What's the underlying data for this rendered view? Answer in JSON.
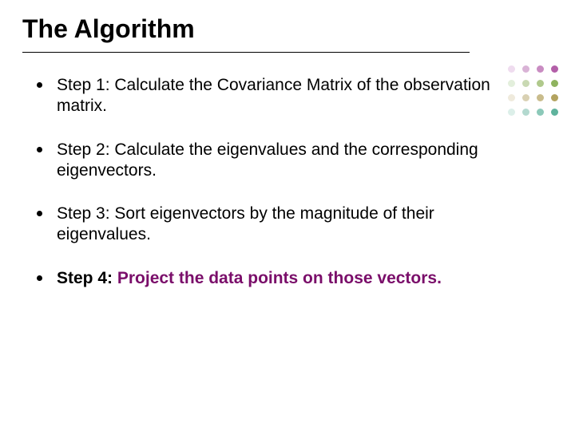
{
  "title": "The Algorithm",
  "bullets": [
    {
      "prefix": "Step 1: ",
      "body": "Calculate the Covariance Matrix of the observation matrix.",
      "highlight": ""
    },
    {
      "prefix": "Step 2: ",
      "body": "Calculate the eigenvalues and the corresponding eigenvectors.",
      "highlight": ""
    },
    {
      "prefix": "Step 3: ",
      "body": "Sort eigenvectors by the magnitude of their eigenvalues.",
      "highlight": ""
    },
    {
      "prefix": "Step 4: ",
      "body": "",
      "highlight": "Project the data points on those vectors."
    }
  ],
  "decor_dots": [
    "#efdcef",
    "#d9b3d6",
    "#c98cc2",
    "#b35fa8",
    "#e3efdc",
    "#c9d9b3",
    "#b0c98c",
    "#8fb35f",
    "#efeadc",
    "#d9d1b3",
    "#c9bc8c",
    "#b3a35f",
    "#dcefe9",
    "#b3d9cf",
    "#8cc9b9",
    "#5fb39d"
  ]
}
